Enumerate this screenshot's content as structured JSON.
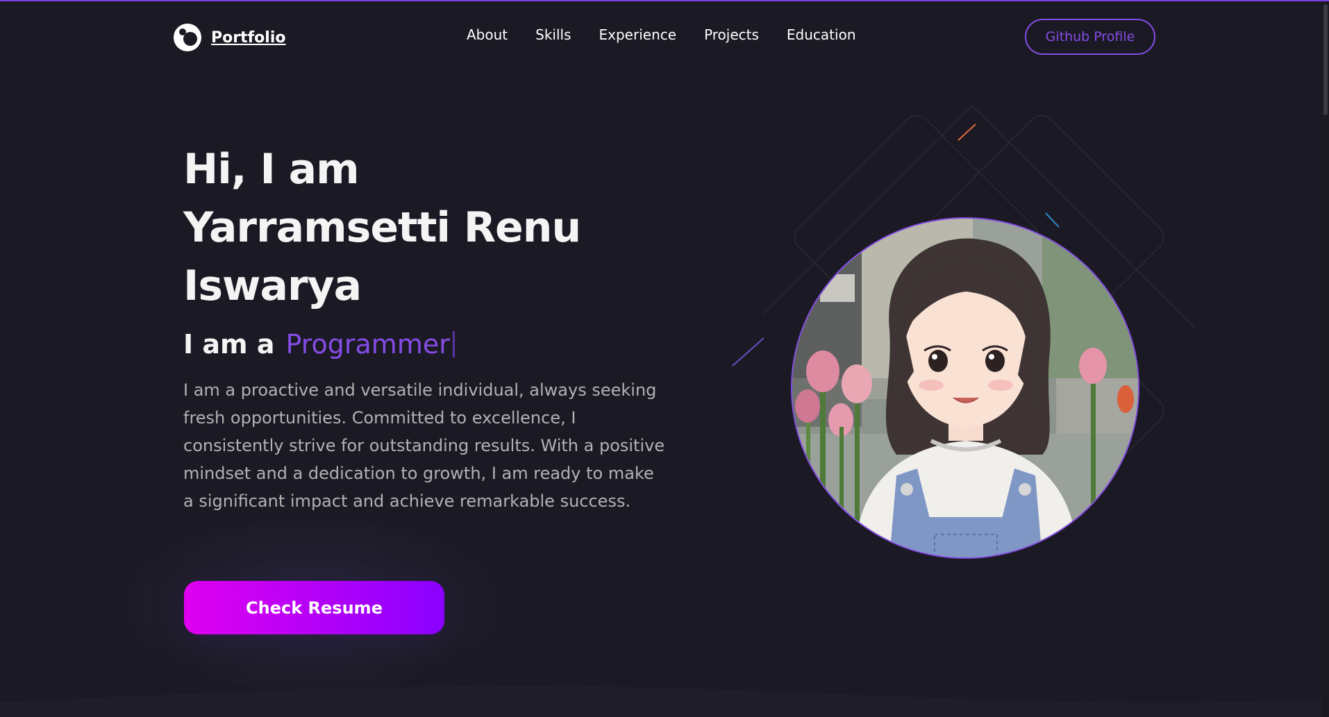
{
  "nav": {
    "logo_text": "Portfolio",
    "links": [
      "About",
      "Skills",
      "Experience",
      "Projects",
      "Education"
    ],
    "github_label": "Github Profile"
  },
  "hero": {
    "title_line1": "Hi, I am",
    "title_line2": "Yarramsetti Renu",
    "title_line3": "Iswarya",
    "role_prefix": "I am a",
    "role_word": "Programmer",
    "bio": "I am a proactive and versatile individual, always seeking fresh opportunities. Committed to excellence, I consistently strive for outstanding results. With a positive mindset and a dedication to growth, I am ready to make a significant impact and achieve remarkable success.",
    "resume_label": "Check Resume"
  },
  "colors": {
    "accent": "#854ce6",
    "background": "#1b1a24",
    "button_gradient_start": "#e000f0",
    "button_gradient_end": "#8a00ff"
  },
  "icons": {
    "logo": "portfolio-logo-icon",
    "avatar": "profile-avatar-illustration"
  }
}
